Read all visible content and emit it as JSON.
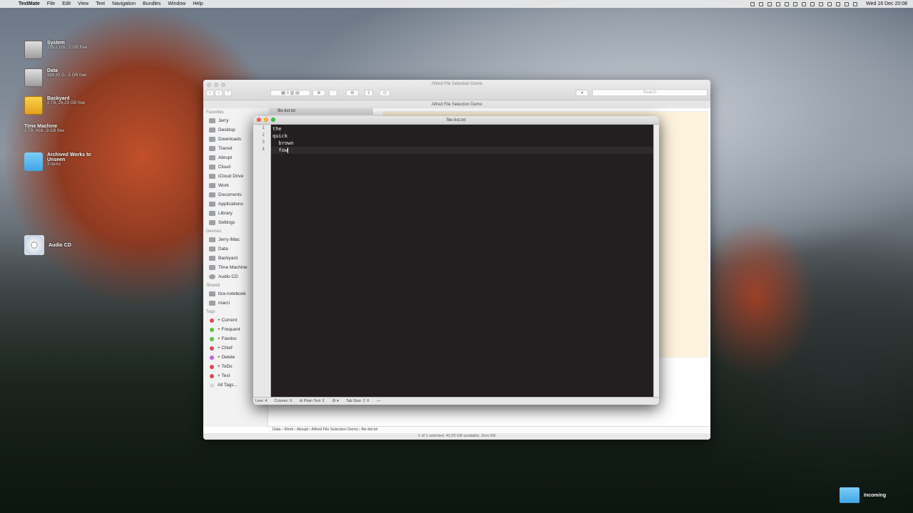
{
  "menubar": {
    "app": "TextMate",
    "items": [
      "File",
      "Edit",
      "View",
      "Text",
      "Navigation",
      "Bundles",
      "Window",
      "Help"
    ],
    "clock": "Wed 16 Dec  20:08"
  },
  "desktop": {
    "icons": [
      {
        "name": "System",
        "sub": "239,2 GB...2 GB free"
      },
      {
        "name": "Data",
        "sub": "999,35 G...3 GB free"
      },
      {
        "name": "Backyard",
        "sub": "2 TB, 26,29 GB free"
      },
      {
        "name": "Time Machine",
        "sub": "2 TB, 416...9 GB free"
      },
      {
        "name": "Archived Works to Unseen",
        "sub": "3 items"
      },
      {
        "name": "Audio CD",
        "sub": ""
      }
    ],
    "incoming": "Incoming"
  },
  "finder": {
    "title": "Alfred File Selection Demo",
    "path_title": "Alfred File Selection Demo",
    "search_placeholder": "Search",
    "selected_file": "file-list.txt",
    "sidebar": {
      "favorites_label": "Favorites",
      "favorites": [
        "Jerry",
        "Desktop",
        "Downloads",
        "Transit",
        "Abrupt",
        "Cloud",
        "iCloud Drive",
        "Work",
        "Documents",
        "Applications",
        "Library",
        "Settings"
      ],
      "devices_label": "Devices",
      "devices": [
        "Jerry iMac",
        "Data",
        "Backyard",
        "Time Machine",
        "Audio CD"
      ],
      "shared_label": "Shared",
      "shared": [
        "liza-notebook",
        "marci"
      ],
      "tags_label": "Tags",
      "tags": [
        {
          "label": "+ Current",
          "color": "#e0474f"
        },
        {
          "label": "+ Frequent",
          "color": "#5ac43e"
        },
        {
          "label": "+ Favdoc",
          "color": "#5ac43e"
        },
        {
          "label": "+ Chief",
          "color": "#e0474f"
        },
        {
          "label": "+ Delete",
          "color": "#c260d6"
        },
        {
          "label": "+ ToDo",
          "color": "#e0474f"
        },
        {
          "label": "+ Test",
          "color": "#e0474f"
        },
        {
          "label": "All Tags...",
          "color": "#d8d8d8"
        }
      ]
    },
    "pathbar": [
      "Data",
      "Work",
      "Abrupt",
      "Alfred File Selection Demo",
      "file-list.txt"
    ],
    "status": "1 of 1 selected, 43,03 GB available, Zero KB"
  },
  "textmate": {
    "title": "file-list.txt",
    "lines": [
      "the",
      "quick",
      "  brown",
      "  fow"
    ],
    "line_numbers": [
      "1",
      "2",
      "3",
      "4"
    ],
    "status": {
      "line": "Line: 4",
      "column": "Column: 6",
      "grammar": "Plain Text",
      "tab": "Tab Size:",
      "tab_value": "2"
    }
  }
}
